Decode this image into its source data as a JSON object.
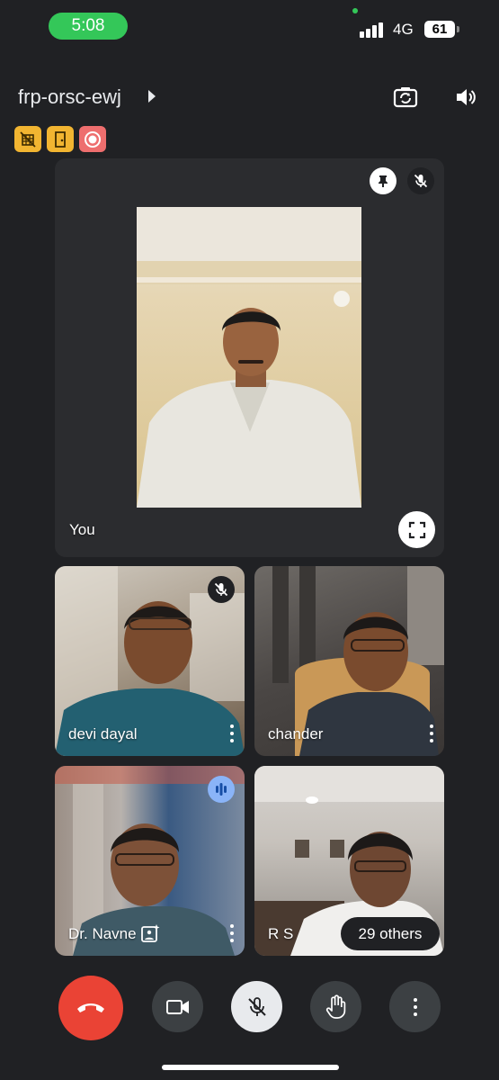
{
  "status_bar": {
    "time": "5:08",
    "network": "4G",
    "battery": "61"
  },
  "header": {
    "meeting_code": "frp-orsc-ewj",
    "icons": [
      "switch-camera-icon",
      "speaker-icon"
    ],
    "badges": [
      "host-controls-icon",
      "door-icon",
      "recording-icon"
    ]
  },
  "main_tile": {
    "name": "You",
    "icons": [
      "pin-icon",
      "mic-off-icon",
      "fullscreen-icon"
    ]
  },
  "participants": [
    {
      "name": "devi dayal",
      "muted": true
    },
    {
      "name": "chander",
      "muted": false
    },
    {
      "name": "Dr. Navne",
      "speaking": true
    },
    {
      "name": "R S"
    }
  ],
  "others_count": "29 others",
  "controls": [
    "end-call-icon",
    "camera-icon",
    "mic-off-icon",
    "raise-hand-icon",
    "more-icon"
  ],
  "colors": {
    "background": "#202124",
    "end_call": "#ea4335",
    "status_green": "#34c759",
    "badge_yellow": "#f2b531",
    "badge_red": "#ee6e6e"
  }
}
